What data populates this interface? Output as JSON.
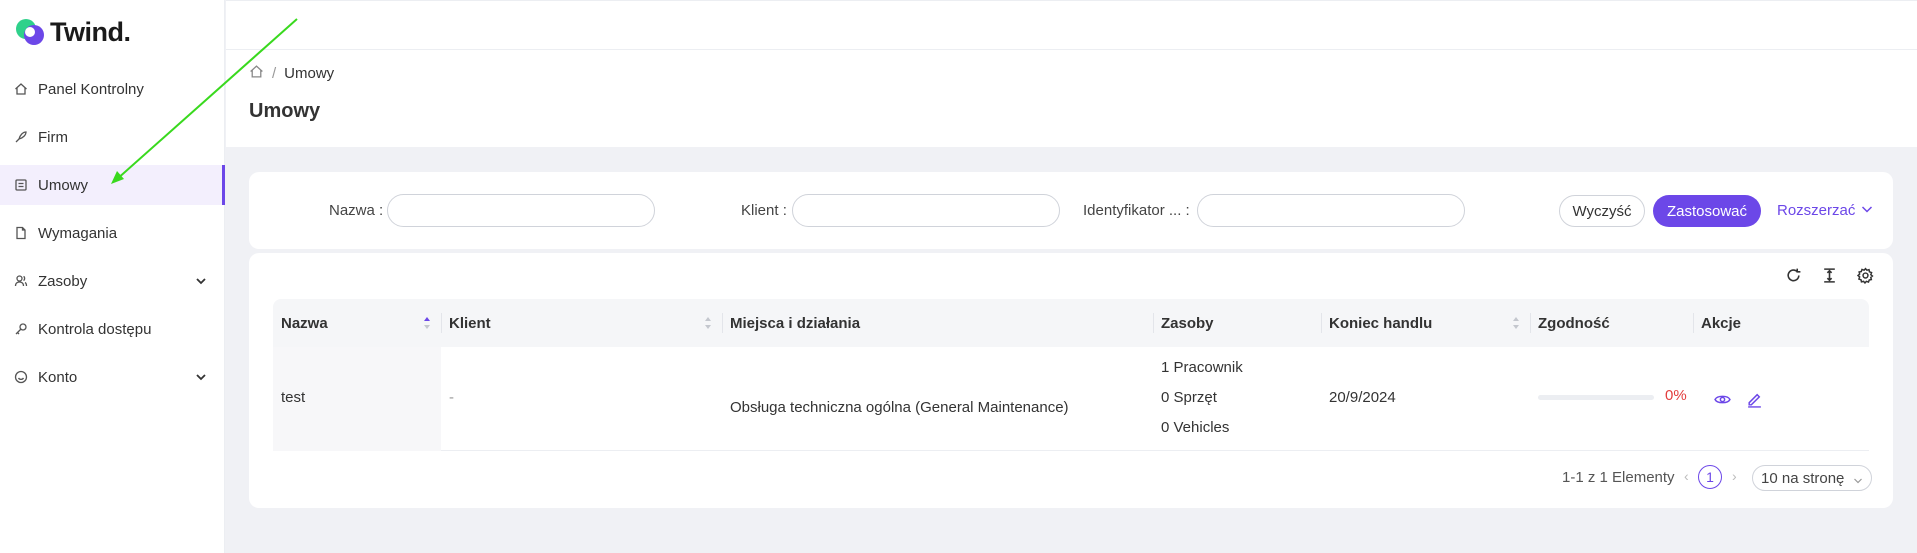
{
  "app": {
    "logo_text": "Twind.",
    "accent": "#6c47e8"
  },
  "sidebar": {
    "items": [
      {
        "label": "Panel Kontrolny",
        "icon": "home-icon"
      },
      {
        "label": "Firm",
        "icon": "rocket-icon"
      },
      {
        "label": "Umowy",
        "icon": "contract-icon",
        "active": true
      },
      {
        "label": "Wymagania",
        "icon": "document-icon"
      },
      {
        "label": "Zasoby",
        "icon": "users-icon",
        "has_children": true
      },
      {
        "label": "Kontrola dostępu",
        "icon": "key-icon"
      },
      {
        "label": "Konto",
        "icon": "smile-icon",
        "has_children": true
      }
    ]
  },
  "breadcrumb": {
    "current": "Umowy"
  },
  "page": {
    "title": "Umowy"
  },
  "filters": {
    "fields": [
      {
        "label": "Nazwa",
        "value": ""
      },
      {
        "label": "Klient",
        "value": ""
      },
      {
        "label": "Identyfikator ...",
        "value": ""
      }
    ],
    "clear_label": "Wyczyść",
    "apply_label": "Zastosować",
    "expand_label": "Rozszerzać"
  },
  "table": {
    "columns": [
      "Nazwa",
      "Klient",
      "Miejsca i działania",
      "Zasoby",
      "Koniec handlu",
      "Zgodność",
      "Akcje"
    ],
    "rows": [
      {
        "name": "test",
        "client": "-",
        "places": "Obsługa techniczna ogólna (General Maintenance)",
        "resources": [
          "1 Pracownik",
          "0 Sprzęt",
          "0 Vehicles"
        ],
        "end_date": "20/9/2024",
        "compliance_pct": "0%",
        "compliance_value": 0
      }
    ]
  },
  "pagination": {
    "summary": "1-1 z 1 Elementy",
    "current_page": "1",
    "page_size": "10 na stronę"
  }
}
